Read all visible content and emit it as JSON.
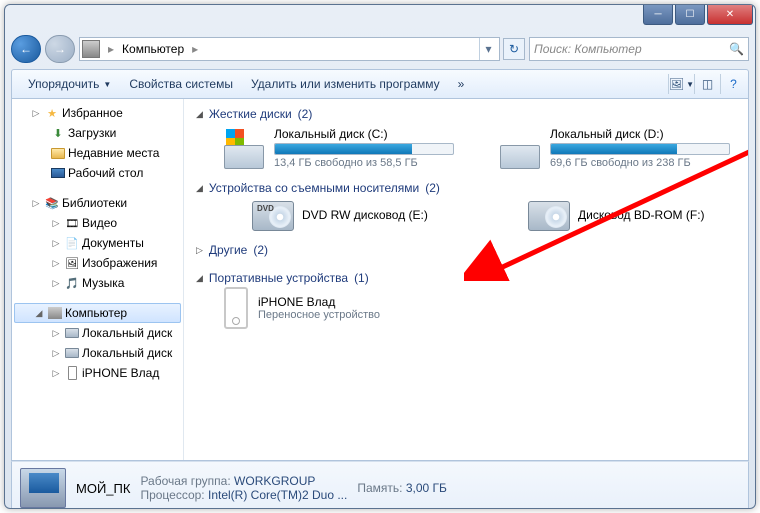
{
  "nav": {
    "breadcrumb": "Компьютер"
  },
  "search": {
    "placeholder": "Поиск: Компьютер"
  },
  "toolbar": {
    "organize": "Упорядочить",
    "properties": "Свойства системы",
    "uninstall": "Удалить или изменить программу",
    "more": "»"
  },
  "sidebar": {
    "favorites": "Избранное",
    "downloads": "Загрузки",
    "recent": "Недавние места",
    "desktop": "Рабочий стол",
    "libraries": "Библиотеки",
    "videos": "Видео",
    "documents": "Документы",
    "pictures": "Изображения",
    "music": "Музыка",
    "computer": "Компьютер",
    "localC": "Локальный диск",
    "localD": "Локальный диск",
    "iphone": "iPHONE Влад"
  },
  "groups": {
    "hdd": {
      "title": "Жесткие диски",
      "count": "(2)"
    },
    "removable": {
      "title": "Устройства со съемными носителями",
      "count": "(2)"
    },
    "other": {
      "title": "Другие",
      "count": "(2)"
    },
    "portable": {
      "title": "Портативные устройства",
      "count": "(1)"
    }
  },
  "drives": {
    "c": {
      "name": "Локальный диск (C:)",
      "free": "13,4 ГБ свободно из 58,5 ГБ",
      "fill_pct": 77
    },
    "d": {
      "name": "Локальный диск (D:)",
      "free": "69,6 ГБ свободно из 238 ГБ",
      "fill_pct": 71
    },
    "dvd": {
      "name": "DVD RW дисковод (E:)"
    },
    "bd": {
      "name": "Дисковод BD-ROM (F:)"
    }
  },
  "portable": {
    "iphone": {
      "name": "iPHONE Влад",
      "sub": "Переносное устройство"
    }
  },
  "details": {
    "name": "МОЙ_ПК",
    "workgroup_lbl": "Рабочая группа:",
    "workgroup": "WORKGROUP",
    "cpu_lbl": "Процессор:",
    "cpu": "Intel(R) Core(TM)2 Duo ...",
    "mem_lbl": "Память:",
    "mem": "3,00 ГБ"
  }
}
